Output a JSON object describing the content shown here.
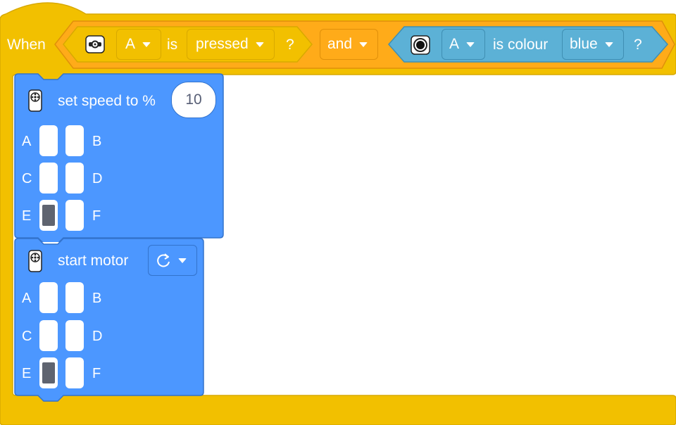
{
  "hat_block": {
    "when_label": "When",
    "button_sensor": {
      "icon": "button-sensor-icon",
      "port": "A",
      "is_label": "is",
      "state": "pressed",
      "question": "?"
    },
    "operator": "and",
    "colour_sensor": {
      "icon": "colour-sensor-icon",
      "port": "A",
      "is_label": "is colour",
      "colour": "blue",
      "question": "?"
    }
  },
  "set_speed_block": {
    "icon": "motor-icon",
    "label": "set speed to %",
    "value": "10",
    "ports": [
      {
        "left": "A",
        "right": "B",
        "left_selected": false,
        "right_selected": false
      },
      {
        "left": "C",
        "right": "D",
        "left_selected": false,
        "right_selected": false
      },
      {
        "left": "E",
        "right": "F",
        "left_selected": true,
        "right_selected": false
      }
    ]
  },
  "start_motor_block": {
    "icon": "motor-icon",
    "label": "start motor",
    "direction_icon": "clockwise-rotate-icon",
    "ports": [
      {
        "left": "A",
        "right": "B",
        "left_selected": false,
        "right_selected": false
      },
      {
        "left": "C",
        "right": "D",
        "left_selected": false,
        "right_selected": false
      },
      {
        "left": "E",
        "right": "F",
        "left_selected": true,
        "right_selected": false
      }
    ]
  },
  "colors": {
    "event_yellow": "#f2c000",
    "operator_orange": "#ffab19",
    "sensor_cyan": "#5cb1d6",
    "motor_blue": "#4c97ff",
    "selected_port": "#5f6470"
  }
}
